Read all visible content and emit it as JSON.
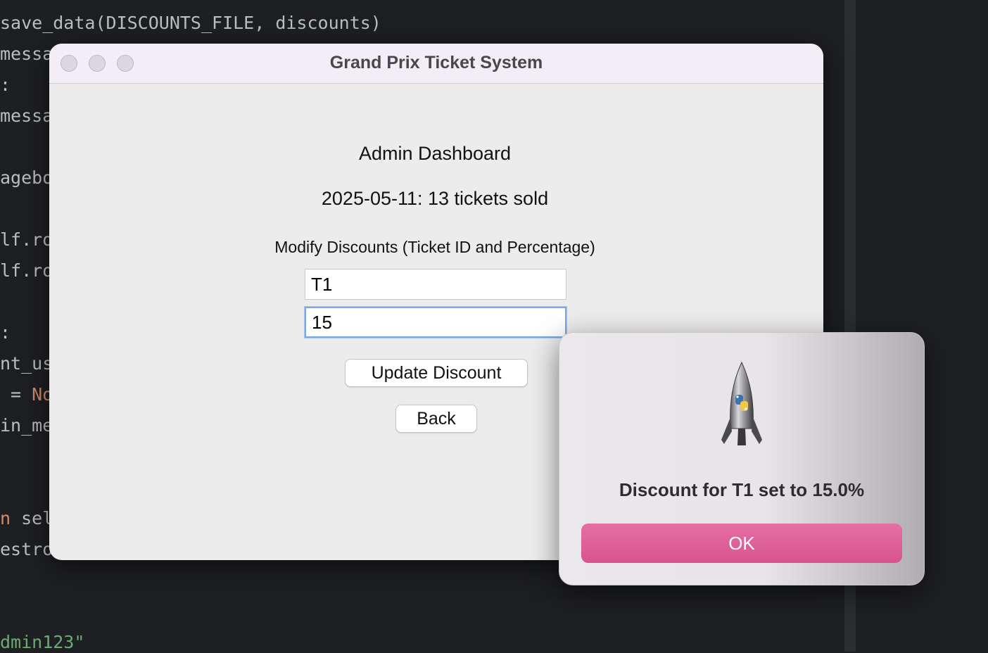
{
  "editor": {
    "lines": [
      {
        "segments": [
          {
            "text": "save_data(DISCOUNTS_FILE, discounts)",
            "cls": ""
          }
        ]
      },
      {
        "segments": [
          {
            "text": "messa",
            "cls": ""
          }
        ]
      },
      {
        "segments": [
          {
            "text": ":",
            "cls": ""
          }
        ]
      },
      {
        "segments": [
          {
            "text": "messa",
            "cls": ""
          }
        ]
      },
      {
        "segments": [
          {
            "text": "agebo",
            "cls": ""
          }
        ]
      },
      {
        "segments": [
          {
            "text": "lf.ro",
            "cls": ""
          }
        ]
      },
      {
        "segments": [
          {
            "text": "lf.ro",
            "cls": ""
          }
        ]
      },
      {
        "segments": [
          {
            "text": ":",
            "cls": ""
          }
        ]
      },
      {
        "segments": [
          {
            "text": "nt_us",
            "cls": ""
          }
        ]
      },
      {
        "segments": [
          {
            "text": " = ",
            "cls": ""
          },
          {
            "text": "No",
            "cls": "tok-kw"
          }
        ]
      },
      {
        "segments": [
          {
            "text": "in_me",
            "cls": ""
          }
        ]
      },
      {
        "segments": [
          {
            "text": "n",
            "cls": "tok-kw"
          },
          {
            "text": " sel",
            "cls": ""
          }
        ]
      },
      {
        "segments": [
          {
            "text": "estro",
            "cls": ""
          }
        ]
      },
      {
        "segments": [
          {
            "text": "dmin123\"",
            "cls": "tok-str"
          }
        ]
      }
    ]
  },
  "window": {
    "title": "Grand Prix Ticket System"
  },
  "dashboard": {
    "heading": "Admin Dashboard",
    "sales_line": "2025-05-11: 13 tickets sold",
    "modify_label": "Modify Discounts (Ticket ID and Percentage)",
    "ticket_id_value": "T1",
    "percentage_value": "15",
    "update_button": "Update Discount",
    "back_button": "Back"
  },
  "alert": {
    "icon": "python-launcher-rocket-icon",
    "message": "Discount for T1 set to 15.0%",
    "ok_button": "OK"
  },
  "colors": {
    "accent_ok": "#dd5c96",
    "focus_ring": "#7aa7e8",
    "keyword": "#cf8e6d",
    "string": "#6aab73"
  }
}
